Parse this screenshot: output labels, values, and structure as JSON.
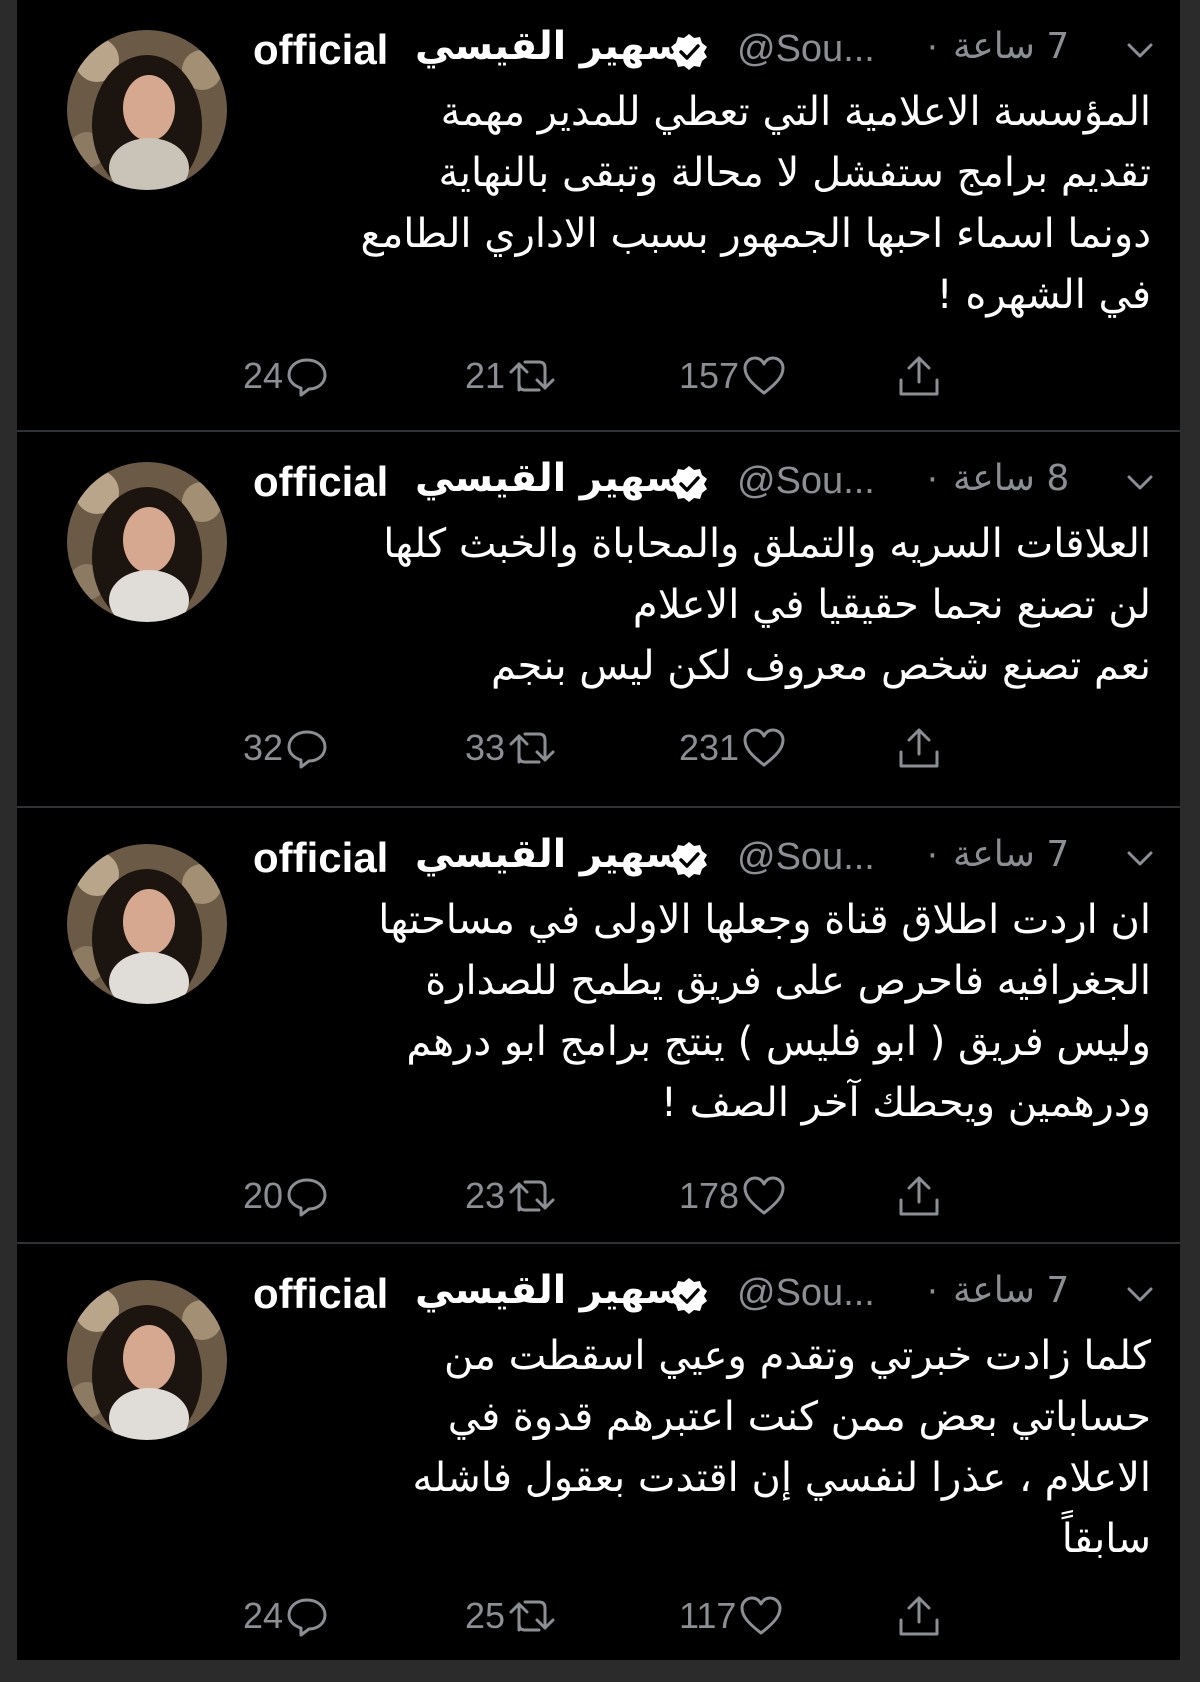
{
  "tweets": [
    {
      "display_name_arabic": "سهير القيسي",
      "display_name_suffix": "official",
      "handle": "@Sou...",
      "dot": "·",
      "time": "7 ساعة",
      "text": "المؤسسة الاعلامية التي تعطي للمدير مهمة\nتقديم برامج ستفشل لا محالة وتبقى بالنهاية\nدونما اسماء احبها الجمهور بسبب الاداري الطامع\nفي الشهره !",
      "replies": "24",
      "retweets": "21",
      "likes": "157"
    },
    {
      "display_name_arabic": "سهير القيسي",
      "display_name_suffix": "official",
      "handle": "@Sou...",
      "dot": "·",
      "time": "8 ساعة",
      "text": "العلاقات السريه والتملق والمحاباة والخبث كلها\nلن تصنع نجما حقيقيا في الاعلام\nنعم تصنع شخص معروف لكن ليس بنجم",
      "replies": "32",
      "retweets": "33",
      "likes": "231"
    },
    {
      "display_name_arabic": "سهير القيسي",
      "display_name_suffix": "official",
      "handle": "@Sou...",
      "dot": "·",
      "time": "7 ساعة",
      "text": "ان اردت اطلاق قناة وجعلها الاولى في مساحتها\nالجغرافيه فاحرص على فريق يطمح للصدارة\nوليس فريق ( ابو فليس ) ينتج برامج ابو درهم\nودرهمين ويحطك آخر الصف !",
      "replies": "20",
      "retweets": "23",
      "likes": "178"
    },
    {
      "display_name_arabic": "سهير القيسي",
      "display_name_suffix": "official",
      "handle": "@Sou...",
      "dot": "·",
      "time": "7 ساعة",
      "text": "كلما زادت خبرتي وتقدم وعيي اسقطت من\nحساباتي بعض ممن كنت اعتبرهم قدوة في\nالاعلام ، عذرا لنفسي إن اقتدت بعقول فاشله\nسابقاً",
      "replies": "24",
      "retweets": "25",
      "likes": "117"
    }
  ],
  "icons": {
    "reply": "reply-icon",
    "retweet": "retweet-icon",
    "like": "heart-icon",
    "share": "share-icon",
    "verified": "verified-badge-icon",
    "caret": "chevron-down-icon"
  },
  "colors": {
    "background": "#000000",
    "text": "#ffffff",
    "secondary": "#8b8f94",
    "divider": "#2f3336",
    "verified_badge": "#ffffff"
  }
}
